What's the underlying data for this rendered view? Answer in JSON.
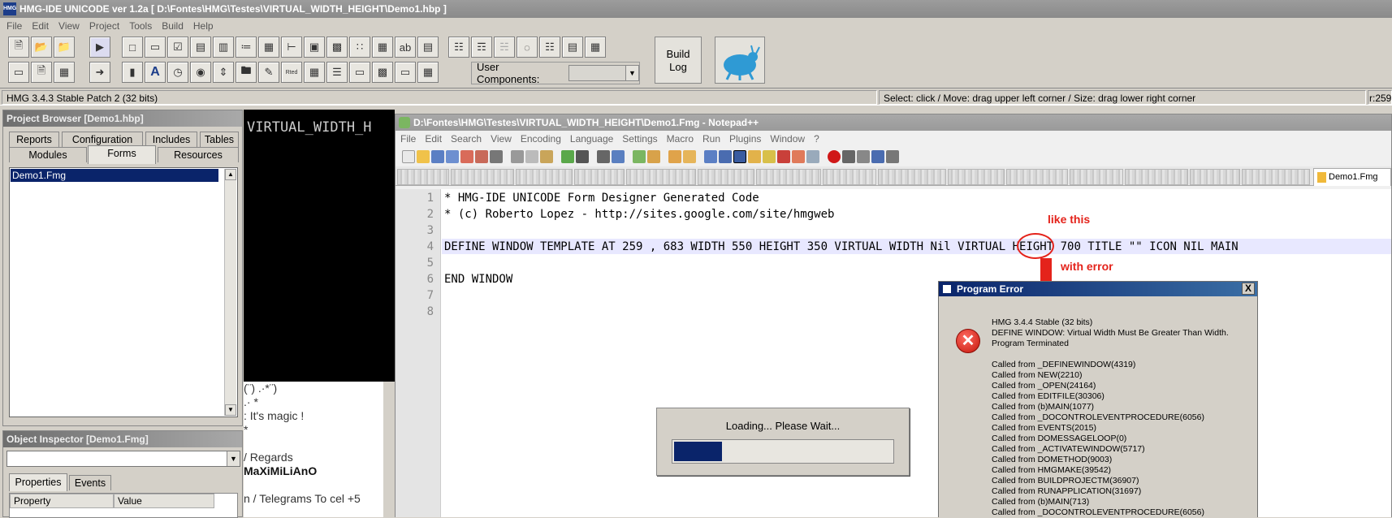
{
  "ide": {
    "title": "HMG-IDE  UNICODE  ver 1.2a  [ D:\\Fontes\\HMG\\Testes\\VIRTUAL_WIDTH_HEIGHT\\Demo1.hbp ]",
    "menu": [
      "File",
      "Edit",
      "View",
      "Project",
      "Tools",
      "Build",
      "Help"
    ],
    "build_log": [
      "Build",
      "Log"
    ],
    "user_components_label": "User Components:",
    "status_version": "HMG 3.4.3 Stable Patch 2 (32 bits)",
    "status_hint": "Select: click / Move: drag upper left corner / Size: drag lower right corner",
    "status_pos": "r:259"
  },
  "project_browser": {
    "title": "Project Browser [Demo1.hbp]",
    "tabs_row1": [
      "Reports",
      "Configuration",
      "Includes",
      "Tables"
    ],
    "tabs_row2": [
      "Modules",
      "Forms",
      "Resources"
    ],
    "selected_tab": "Forms",
    "items": [
      "Demo1.Fmg"
    ]
  },
  "object_inspector": {
    "title": "Object Inspector [Demo1.Fmg]",
    "tabs": [
      "Properties",
      "Events"
    ],
    "columns": [
      "Property",
      "Value"
    ]
  },
  "background": {
    "black_text": "VIRTUAL_WIDTH_H",
    "chat_lines": [
      "(¨) .·*¨)",
      ".· *",
      ": It's magic !",
      "*",
      "",
      "/ Regards",
      "MaXiMiLiAnO",
      "",
      "n / Telegrams To cel +5"
    ]
  },
  "notepad": {
    "title": "D:\\Fontes\\HMG\\Testes\\VIRTUAL_WIDTH_HEIGHT\\Demo1.Fmg - Notepad++",
    "menu": [
      "File",
      "Edit",
      "Search",
      "View",
      "Encoding",
      "Language",
      "Settings",
      "Macro",
      "Run",
      "Plugins",
      "Window",
      "?"
    ],
    "active_tab": "Demo1.Fmg",
    "line_numbers": [
      "1",
      "2",
      "3",
      "4",
      "5",
      "6",
      "7",
      "8"
    ],
    "lines": [
      "* HMG-IDE UNICODE Form Designer Generated Code",
      "* (c) Roberto Lopez - http://sites.google.com/site/hmgweb",
      "",
      "DEFINE WINDOW TEMPLATE AT 259 , 683 WIDTH 550 HEIGHT 350 VIRTUAL WIDTH Nil VIRTUAL HEIGHT 700 TITLE \"\" ICON NIL MAIN",
      "",
      "END WINDOW",
      "",
      ""
    ]
  },
  "annotations": {
    "like_this": "like this",
    "with_error": "with error"
  },
  "loading": {
    "text": "Loading... Please Wait...",
    "progress": 0.22
  },
  "error_dialog": {
    "title": "Program Error",
    "close": "X",
    "message": "HMG 3.4.4 Stable (32 bits)\nDEFINE WINDOW: Virtual Width Must Be Greater Than Width.\nProgram Terminated\n\nCalled from _DEFINEWINDOW(4319)\nCalled from NEW(2210)\nCalled from _OPEN(24164)\nCalled from EDITFILE(30306)\nCalled from (b)MAIN(1077)\nCalled from _DOCONTROLEVENTPROCEDURE(6056)\nCalled from EVENTS(2015)\nCalled from DOMESSAGELOOP(0)\nCalled from _ACTIVATEWINDOW(5717)\nCalled from DOMETHOD(9003)\nCalled from HMGMAKE(39542)\nCalled from BUILDPROJECTM(36907)\nCalled from RUNAPPLICATION(31697)\nCalled from (b)MAIN(713)\nCalled from _DOCONTROLEVENTPROCEDURE(6056)"
  },
  "colors": {
    "accent_red": "#e4231b",
    "selection_blue": "#0a246a"
  }
}
